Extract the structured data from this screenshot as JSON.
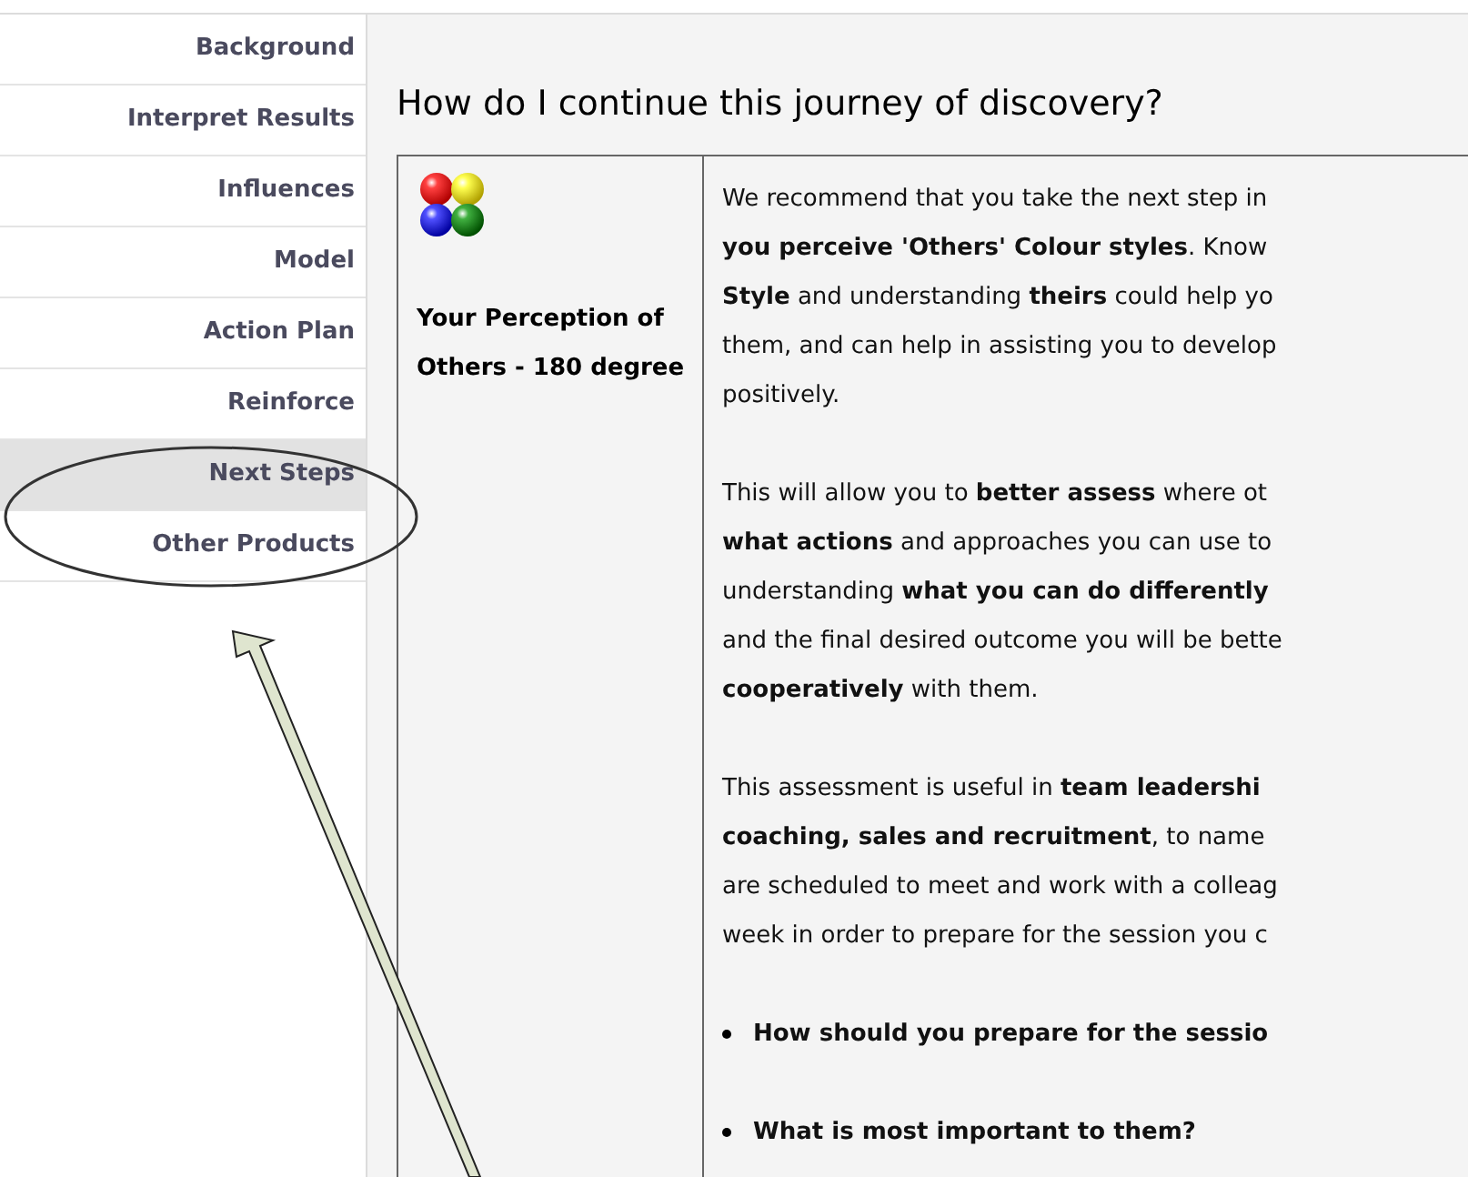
{
  "sidebar": {
    "items": [
      {
        "label": "Background",
        "selected": false
      },
      {
        "label": "Interpret Results",
        "selected": false
      },
      {
        "label": "Influences",
        "selected": false
      },
      {
        "label": "Model",
        "selected": false
      },
      {
        "label": "Action Plan",
        "selected": false
      },
      {
        "label": "Reinforce",
        "selected": false
      },
      {
        "label": "Next Steps",
        "selected": true
      },
      {
        "label": "Other Products",
        "selected": false
      }
    ]
  },
  "heading": "How do I continue this journey of discovery?",
  "product": {
    "title": "Your Perception of Others - 180 degree",
    "paragraphs": [
      [
        "We recommend that you take the next step in",
        "**you perceive 'Others' Colour styles**. Know",
        "**Style** and understanding **theirs** could help yo",
        "them, and can help in assisting you to develop",
        "positively."
      ],
      [
        "This will allow you to **better assess** where ot",
        "**what actions** and approaches you can use to",
        "understanding **what you can do differently**",
        "and the final desired outcome you will be bette",
        "**cooperatively** with them."
      ],
      [
        "This assessment is useful in **team leadershi**",
        "**coaching, sales and recruitment**, to name",
        "are scheduled to meet and work with a colleag",
        "week in order to prepare for the session you c"
      ]
    ],
    "bullets": [
      "How should you prepare for the sessio",
      "What is most important to them?"
    ]
  }
}
